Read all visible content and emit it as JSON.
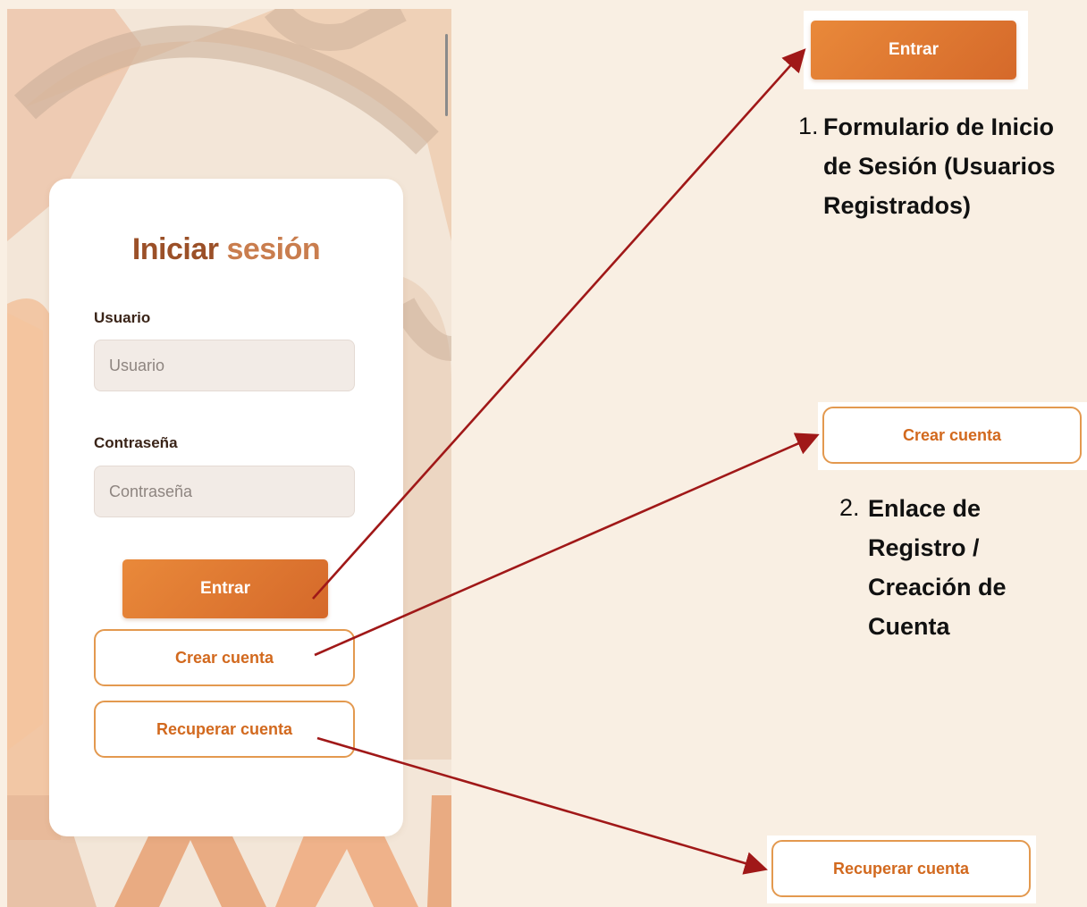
{
  "login": {
    "title_part1": "Iniciar",
    "title_part2": "sesión",
    "username_label": "Usuario",
    "username_placeholder": "Usuario",
    "password_label": "Contraseña",
    "password_placeholder": "Contraseña",
    "submit_label": "Entrar",
    "create_account_label": "Crear cuenta",
    "recover_account_label": "Recuperar cuenta"
  },
  "annotations": [
    {
      "number": "1.",
      "text": "Formulario de Inicio de Sesión (Usuarios Registrados)",
      "button_label": "Entrar"
    },
    {
      "number": "2.",
      "text": "Enlace de Registro / Creación de Cuenta",
      "button_label": "Crear cuenta"
    },
    {
      "button_label": "Recuperar cuenta"
    }
  ],
  "colors": {
    "page_background": "#f9efe3",
    "accent_orange": "#e0782f",
    "title_brown": "#9b5028",
    "outline_orange": "#e3994f",
    "arrow_red": "#a01818"
  }
}
